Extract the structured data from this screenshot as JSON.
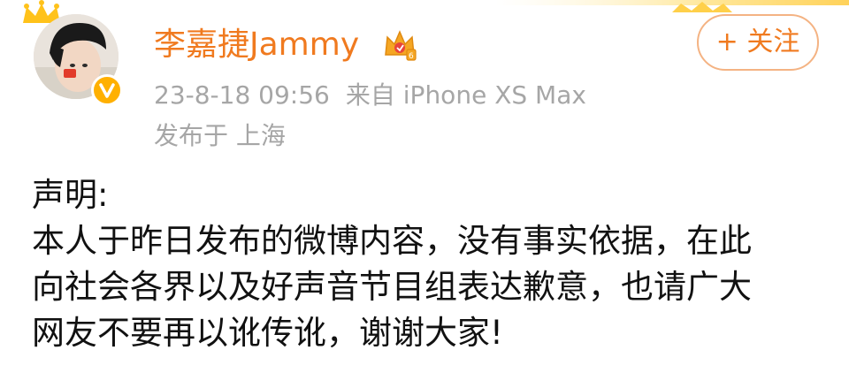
{
  "post": {
    "username": "李嘉捷Jammy",
    "follow_label": "+ 关注",
    "timestamp": "23-8-18 09:56",
    "source": "来自 iPhone XS Max",
    "location": "发布于 上海",
    "content_lines": [
      "声明:",
      "本人于昨日发布的微博内容，没有事实依据，在此",
      "向社会各界以及好声音节目组表达歉意，也请广大",
      "网友不要再以讹传讹，谢谢大家!"
    ]
  },
  "colors": {
    "username": "#f07a1f",
    "meta": "#a6a6a6",
    "verified_badge": "#ffb000",
    "follow_border": "#f4b383"
  },
  "icons": {
    "verified": "verified-v-badge-icon",
    "vip": "vip-crown-icon",
    "decoration": "crown-decoration-icon"
  }
}
